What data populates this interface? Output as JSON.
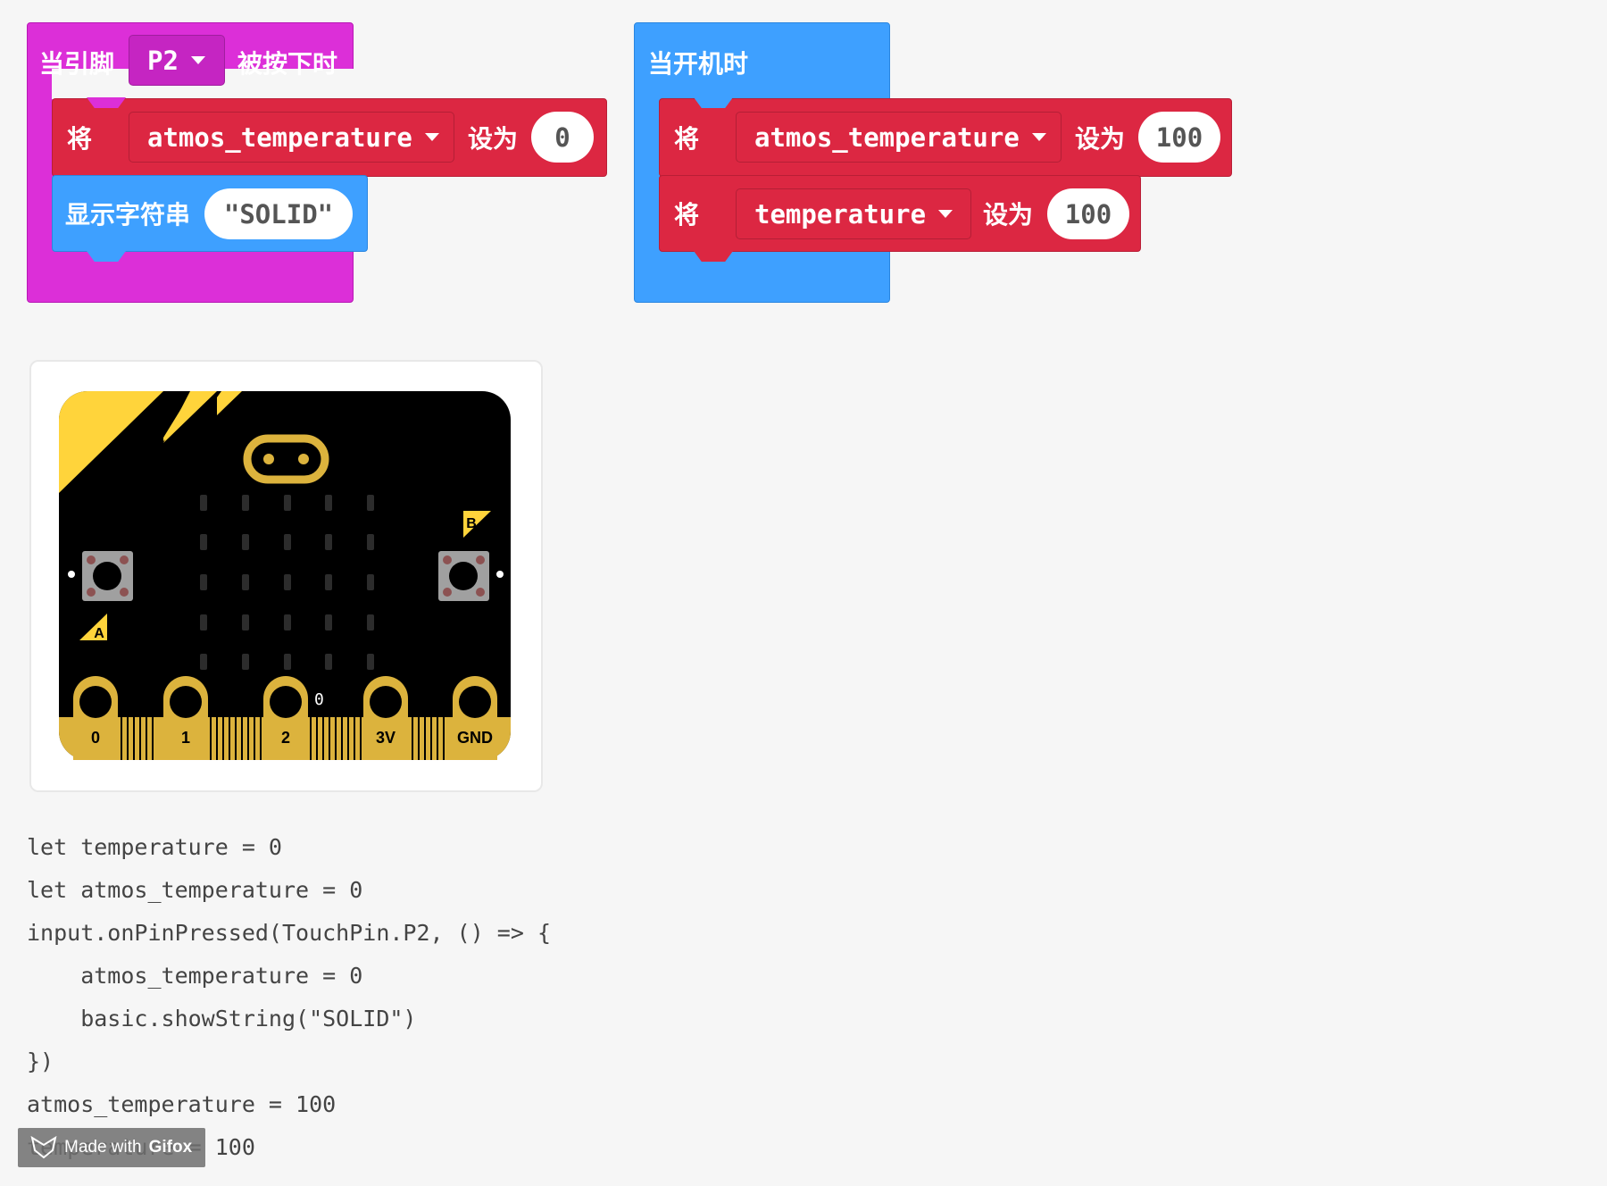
{
  "pin_event": {
    "label_prefix": "当引脚",
    "pin": "P2",
    "label_suffix": "被按下时",
    "set_block": {
      "keyword": "将",
      "variable": "atmos_temperature",
      "to_label": "设为",
      "value": "0"
    },
    "show_block": {
      "label": "显示字符串",
      "value": "\"SOLID\""
    }
  },
  "on_start": {
    "label": "当开机时",
    "set_block_1": {
      "keyword": "将",
      "variable": "atmos_temperature",
      "to_label": "设为",
      "value": "100"
    },
    "set_block_2": {
      "keyword": "将",
      "variable": "temperature",
      "to_label": "设为",
      "value": "100"
    }
  },
  "simulator": {
    "button_a": "A",
    "button_b": "B",
    "pin_labels": [
      "0",
      "1",
      "2",
      "3V",
      "GND"
    ],
    "pin2_value": "0"
  },
  "code_lines": [
    "let temperature = 0",
    "let atmos_temperature = 0",
    "input.onPinPressed(TouchPin.P2, () => {",
    "    atmos_temperature = 0",
    "    basic.showString(\"SOLID\")",
    "})",
    "atmos_temperature = 100",
    "temperature = 100"
  ],
  "badge": {
    "prefix": "Made with",
    "brand": "Gifox"
  },
  "colors": {
    "pins_magenta": "#dc2fd8",
    "variables_red": "#dc2742",
    "basic_blue": "#3ea0ff",
    "board_gold": "#dcb33d",
    "board_yellow": "#ffd43b"
  }
}
